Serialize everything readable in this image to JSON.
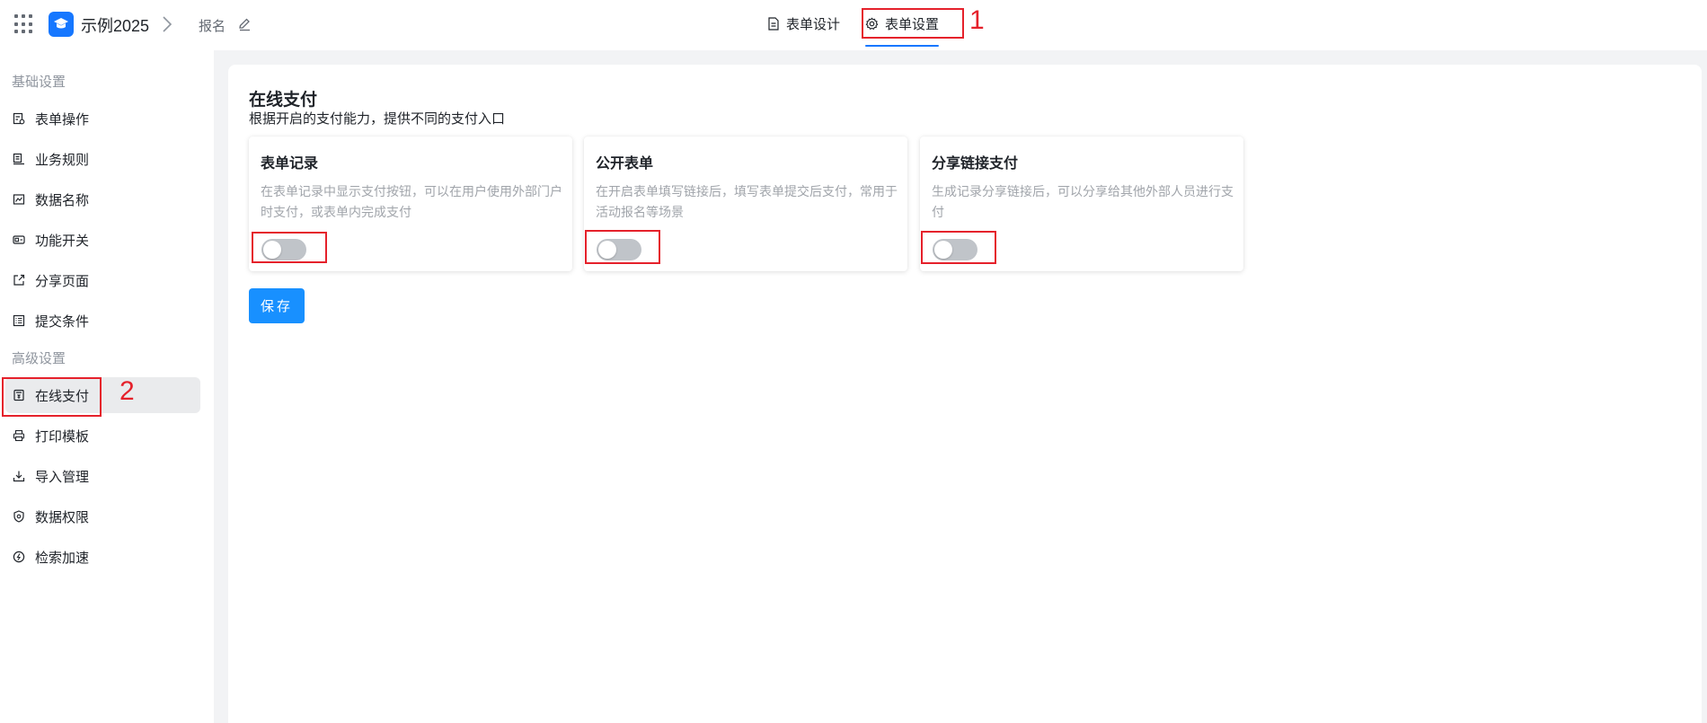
{
  "header": {
    "app_name": "示例2025",
    "form_name": "报名",
    "tabs": [
      {
        "label": "表单设计",
        "icon": "document-icon",
        "active": false
      },
      {
        "label": "表单设置",
        "icon": "gear-icon",
        "active": true
      }
    ]
  },
  "sidebar": {
    "section_basic": "基础设置",
    "section_advanced": "高级设置",
    "basic_items": [
      {
        "label": "表单操作",
        "icon": "form-ops-icon"
      },
      {
        "label": "业务规则",
        "icon": "rules-icon"
      },
      {
        "label": "数据名称",
        "icon": "data-name-icon"
      },
      {
        "label": "功能开关",
        "icon": "toggle-icon"
      },
      {
        "label": "分享页面",
        "icon": "share-icon"
      },
      {
        "label": "提交条件",
        "icon": "checklist-icon"
      }
    ],
    "advanced_items": [
      {
        "label": "在线支付",
        "icon": "payment-icon",
        "active": true
      },
      {
        "label": "打印模板",
        "icon": "printer-icon"
      },
      {
        "label": "导入管理",
        "icon": "import-icon"
      },
      {
        "label": "数据权限",
        "icon": "shield-icon"
      },
      {
        "label": "检索加速",
        "icon": "speed-icon"
      }
    ]
  },
  "main": {
    "title": "在线支付",
    "description": "根据开启的支付能力，提供不同的支付入口",
    "cards": [
      {
        "title": "表单记录",
        "description": "在表单记录中显示支付按钮，可以在用户使用外部门户时支付，或表单内完成支付",
        "enabled": false
      },
      {
        "title": "公开表单",
        "description": "在开启表单填写链接后，填写表单提交后支付，常用于活动报名等场景",
        "enabled": false
      },
      {
        "title": "分享链接支付",
        "description": "生成记录分享链接后，可以分享给其他外部人员进行支付",
        "enabled": false
      }
    ],
    "save_label": "保存"
  },
  "annotations": {
    "marker_1": "1",
    "marker_2": "2"
  },
  "colors": {
    "primary": "#1677ff",
    "save_button": "#1890ff",
    "annotation": "#e5212b",
    "switch_off": "#c0c4c9"
  }
}
